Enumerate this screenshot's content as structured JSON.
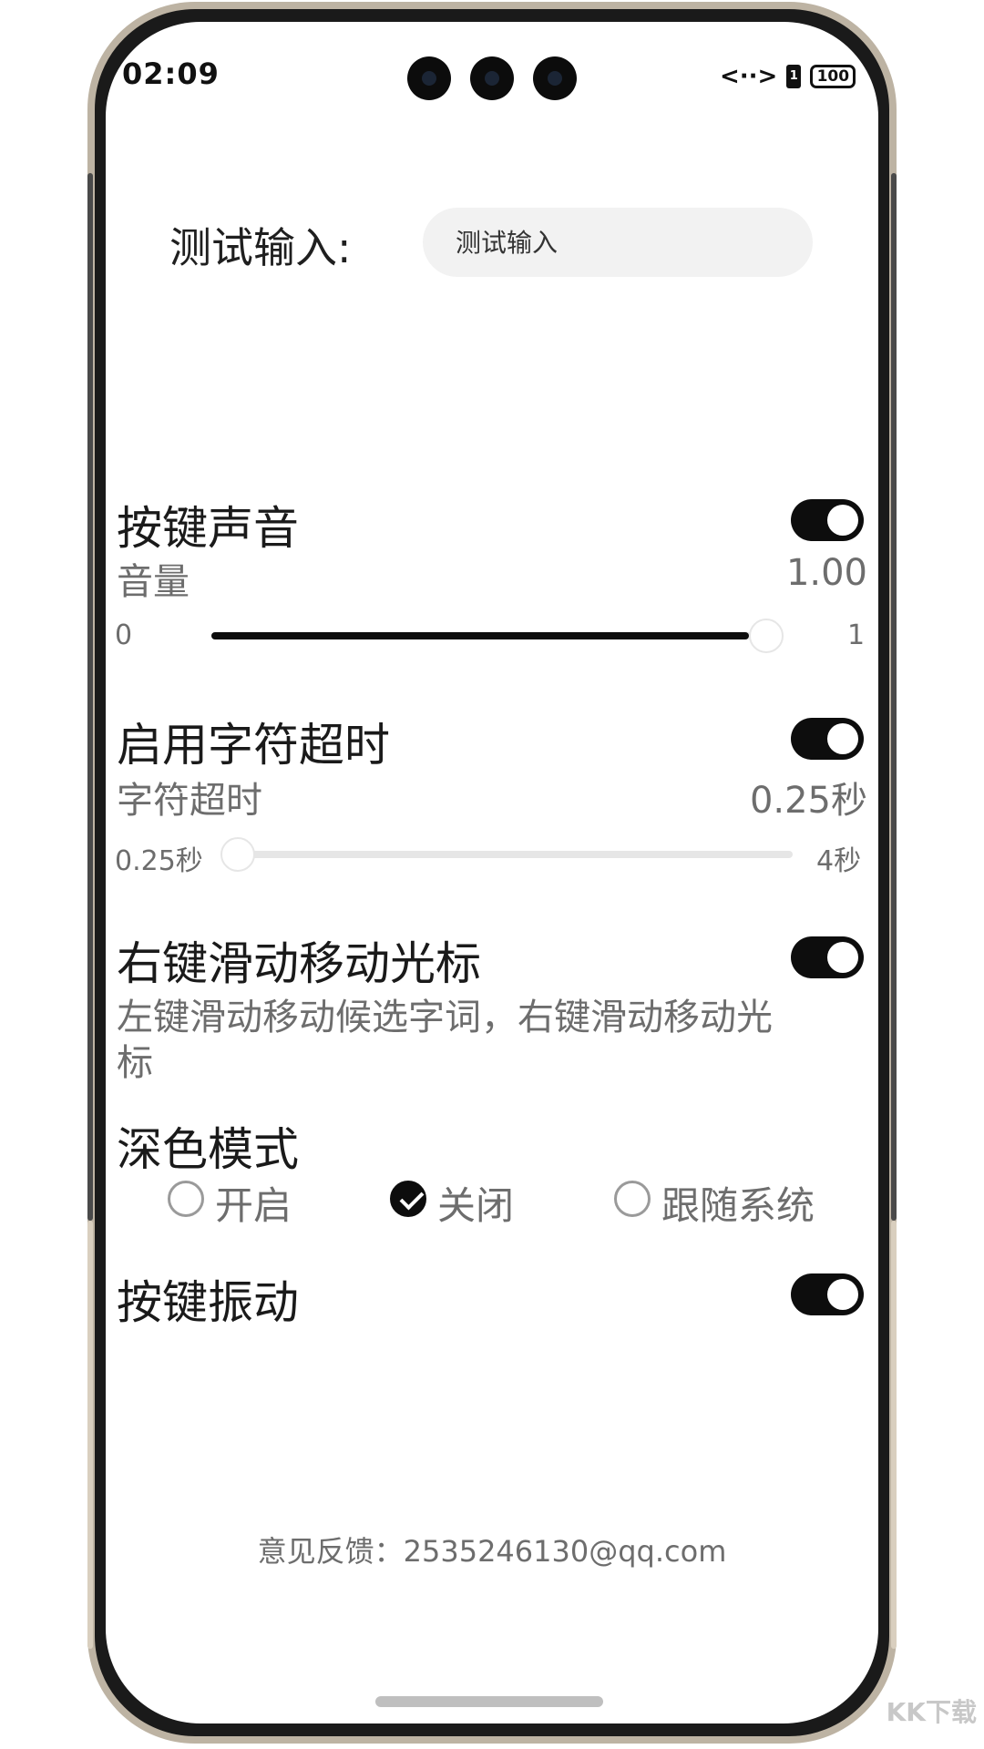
{
  "status_bar": {
    "time": "02:09",
    "data_icon": "<··>",
    "sim_label": "1",
    "battery": "100"
  },
  "test_input": {
    "label": "测试输入:",
    "placeholder": "测试输入"
  },
  "key_sound": {
    "title": "按键声音",
    "enabled": true,
    "volume_label": "音量",
    "volume_value": "1.00",
    "min": "0",
    "max": "1",
    "level": 1.0
  },
  "char_timeout": {
    "title": "启用字符超时",
    "enabled": true,
    "sub_label": "字符超时",
    "value": "0.25秒",
    "min": "0.25秒",
    "max": "4秒",
    "level": 0.0
  },
  "swipe_cursor": {
    "title": "右键滑动移动光标",
    "enabled": true,
    "description_line1": "左键滑动移动候选字词，右键滑动移动光",
    "description_line2": "标"
  },
  "dark_mode": {
    "title": "深色模式",
    "options": [
      {
        "label": "开启",
        "checked": false
      },
      {
        "label": "关闭",
        "checked": true
      },
      {
        "label": "跟随系统",
        "checked": false
      }
    ]
  },
  "key_vibration": {
    "title": "按键振动",
    "enabled": true
  },
  "feedback": {
    "text": "意见反馈：2535246130@qq.com"
  },
  "watermark": "KK下载",
  "colors": {
    "accent": "#0d0d0d",
    "track": "#e6e6e6",
    "input_bg": "#f2f2f2",
    "secondary_text": "#6d6d6d"
  }
}
